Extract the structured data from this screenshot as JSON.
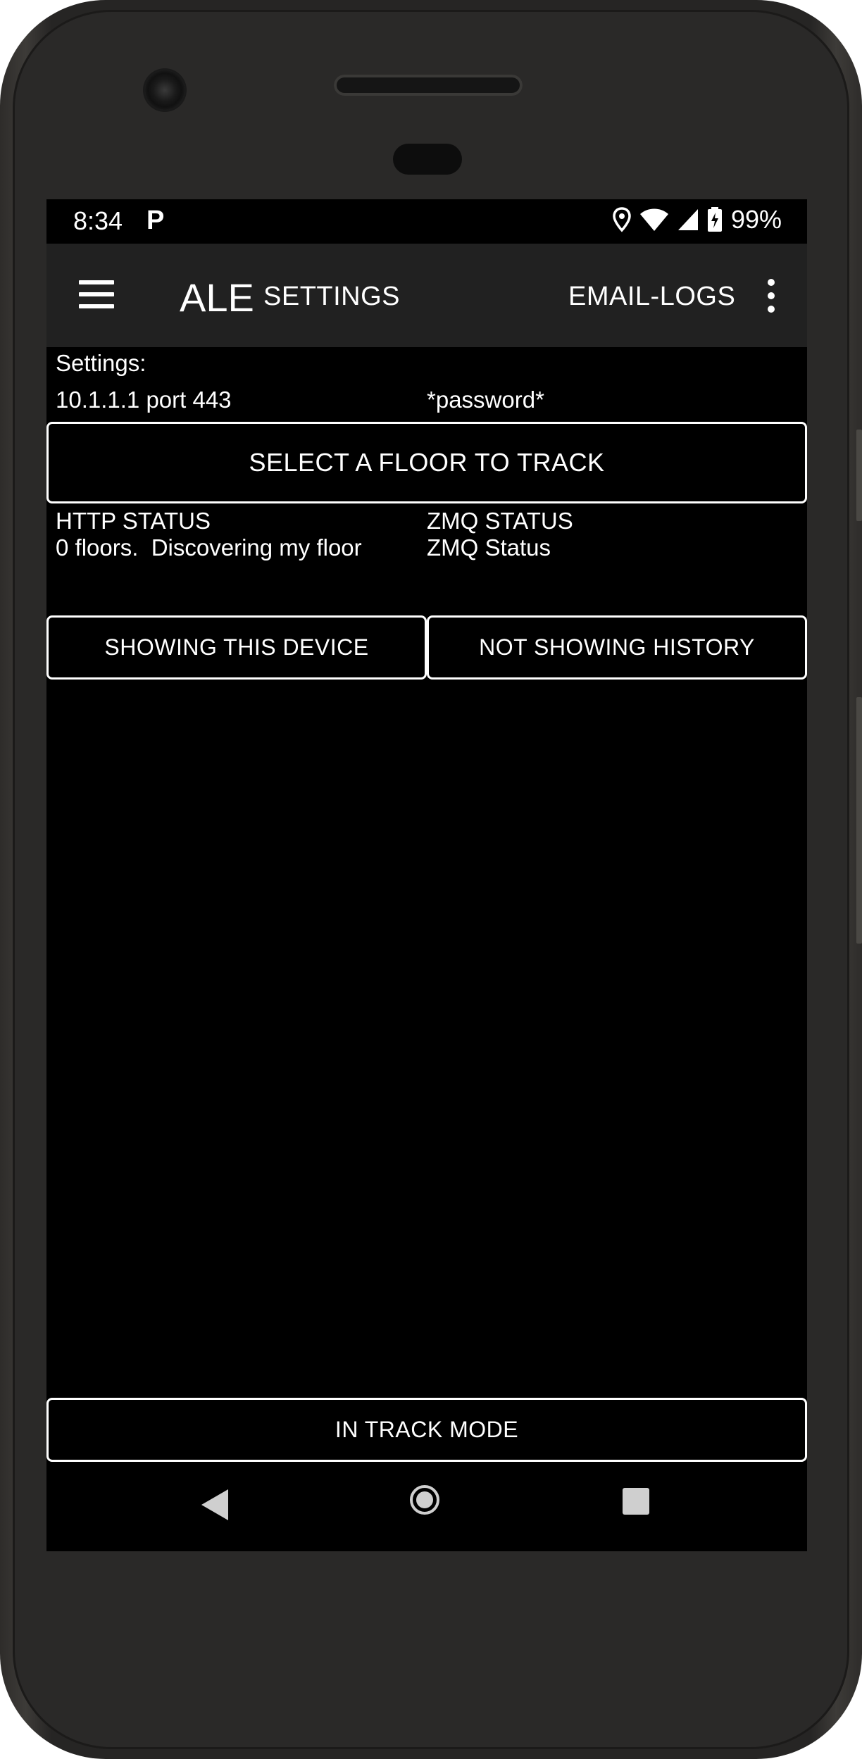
{
  "status_bar": {
    "time": "8:34",
    "notification_icon": "P",
    "battery": "99%",
    "icons": [
      "location-icon",
      "wifi-icon",
      "signal-icon",
      "battery-charging-icon"
    ]
  },
  "app_bar": {
    "title": "ALE",
    "actions": [
      "SETTINGS",
      "EMAIL-LOGS"
    ]
  },
  "settings": {
    "label": "Settings:",
    "server": "10.1.1.1 port 443",
    "password": "*password*"
  },
  "floor_button": "SELECT A FLOOR TO TRACK",
  "http": {
    "title": "HTTP STATUS",
    "value": "0 floors.  Discovering my floor"
  },
  "zmq": {
    "title": "ZMQ STATUS",
    "value": "ZMQ Status"
  },
  "toggles": {
    "device": "SHOWING THIS DEVICE",
    "history": "NOT SHOWING HISTORY"
  },
  "mode_button": "IN TRACK MODE",
  "colors": {
    "screen_background": "#000000",
    "app_bar": "#212121",
    "text": "#ffffff"
  }
}
